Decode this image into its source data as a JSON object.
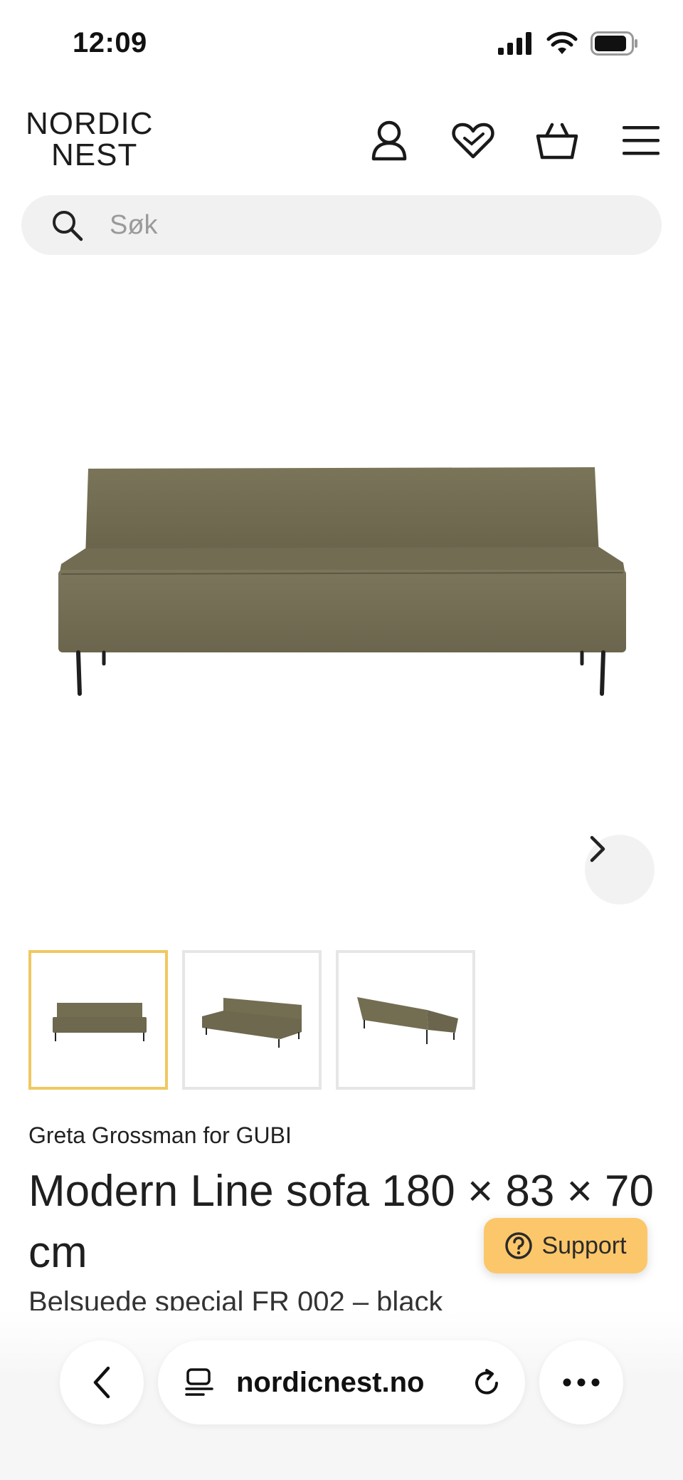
{
  "status_bar": {
    "time": "12:09"
  },
  "header": {
    "logo_line1": "NORDIC",
    "logo_line2": "NEST",
    "icons": [
      "account-icon",
      "wishlist-icon",
      "basket-icon",
      "menu-icon"
    ]
  },
  "search": {
    "placeholder": "Søk",
    "value": ""
  },
  "gallery": {
    "image_count": 3,
    "active_index": 0,
    "sofa_color": "#6f6a52",
    "active_border_color": "#f0c860"
  },
  "product": {
    "designer": "Greta Grossman",
    "for_word": "for",
    "brand": "GUBI",
    "title": "Modern Line sofa 180 × 83 × 70 cm",
    "variant": "Belsuede special FR 002 – black"
  },
  "support": {
    "label": "Support",
    "color": "#fcc76a"
  },
  "browser": {
    "url": "nordicnest.no"
  }
}
